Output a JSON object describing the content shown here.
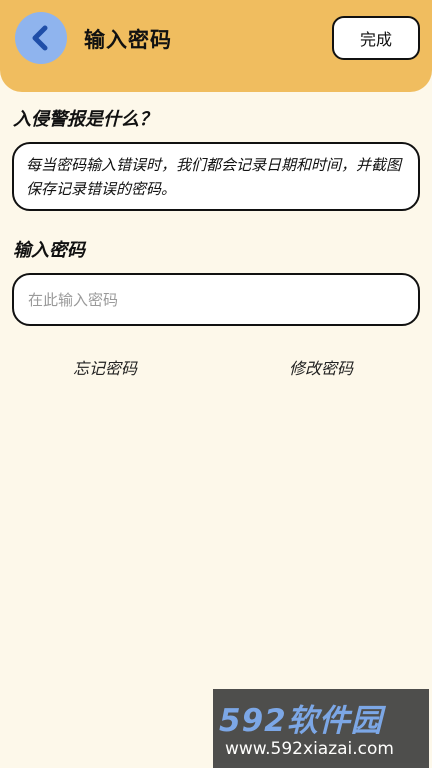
{
  "header": {
    "title": "输入密码",
    "done_label": "完成",
    "back_icon": "chevron-left-icon",
    "background_color": "#f0bd5f"
  },
  "info": {
    "heading": "入侵警报是什么？",
    "text": "每当密码输入错误时，我们都会记录日期和时间，并截图保存记录错误的密码。"
  },
  "password": {
    "heading": "输入密码",
    "placeholder": "在此输入密码",
    "value": ""
  },
  "links": {
    "forgot": "忘记密码",
    "change": "修改密码"
  },
  "watermark": {
    "logo": "592软件园",
    "url": "www.592xiazai.com"
  }
}
